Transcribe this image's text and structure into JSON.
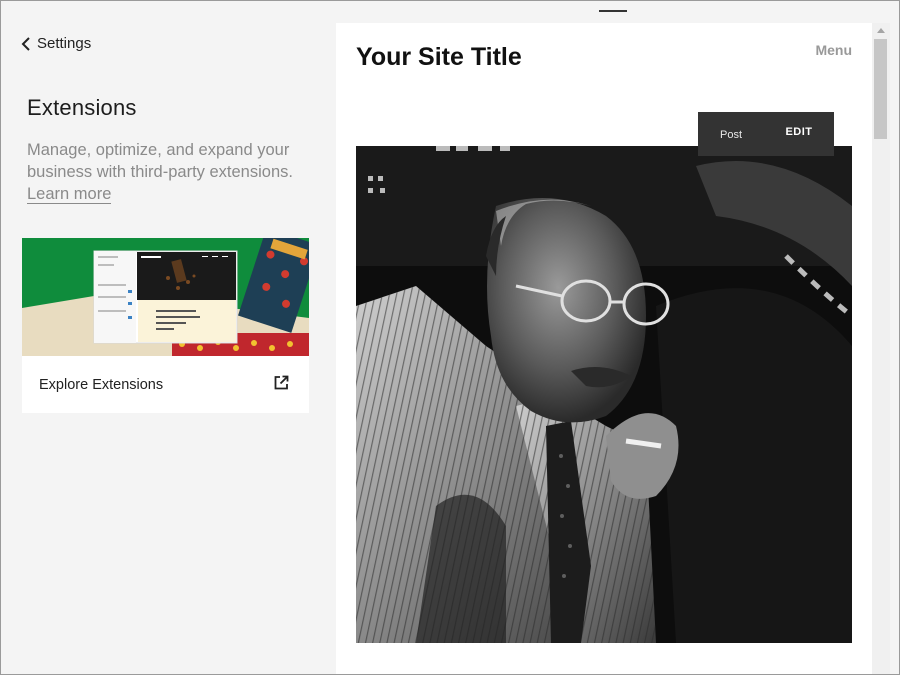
{
  "sidebar": {
    "back_label": "Settings",
    "title": "Extensions",
    "description": "Manage, optimize, and expand your business with third-party extensions.",
    "learn_more": "Learn more",
    "card": {
      "label": "Explore Extensions",
      "image_icon": "extensions-preview-image",
      "link_icon": "external-link-icon"
    }
  },
  "preview": {
    "site_title": "Your Site Title",
    "menu_label": "Menu",
    "toolbar": {
      "post_label": "Post",
      "edit_label": "EDIT"
    },
    "image_icon": "black-and-white-portrait-photo"
  },
  "colors": {
    "sidebar_bg": "#f4f4f4",
    "toolbar_bg": "#333333",
    "card_green": "#0f8c3c",
    "muted_text": "#8a8a8a"
  }
}
